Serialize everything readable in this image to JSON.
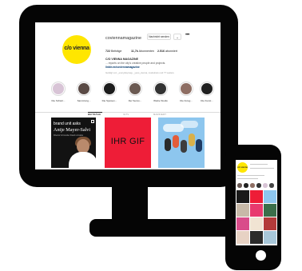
{
  "profile": {
    "avatar_text": "c/o vienna",
    "username": "coviennamagazine",
    "follow_button": "Nachricht senden",
    "chevron": "⌄",
    "more": "•••",
    "stats": [
      {
        "value": "722",
        "label": "Beiträge"
      },
      {
        "value": "11,7k",
        "label": "Abonnenten"
      },
      {
        "value": "2.516",
        "label": "abonniert"
      }
    ],
    "bio_name": "C/O VIENNA MAGAZINE",
    "bio_text": "... reports on the city's creative people and projects.",
    "bio_link": "linktr.ee/coviennamagazine",
    "followed_by": "Gefolgt von _everydaymag, _yeso_vienna, modekreis und 77 weitere"
  },
  "highlights": [
    {
      "label": "Die Schatz...",
      "color": "#d8c4d6"
    },
    {
      "label": "Sammlung...",
      "color": "#5a4a45"
    },
    {
      "label": "Die Speisen...",
      "color": "#1c1c1c"
    },
    {
      "label": "Der Sezes...",
      "color": "#6b5a52"
    },
    {
      "label": "Wiebe Studio",
      "color": "#333333"
    },
    {
      "label": "Die Fotog...",
      "color": "#8e6e63"
    },
    {
      "label": "Die Kunst...",
      "color": "#202020"
    }
  ],
  "tabs": [
    "BEITRÄGE",
    "IGTV",
    "MARKIERT"
  ],
  "posts": {
    "post1": {
      "brand": "brand unit asks",
      "name": "Antje Mayer-Salvi",
      "sub": "Director & Founder brand unit asks"
    },
    "post2": {
      "text": "IHR GIF"
    }
  },
  "colors": {
    "avatar": "#ffe600",
    "post_red": "#ee1d37",
    "sky": "#8dc6ee",
    "frame": "#050505"
  },
  "phone": {
    "avatar_text": "c/o vienna"
  }
}
